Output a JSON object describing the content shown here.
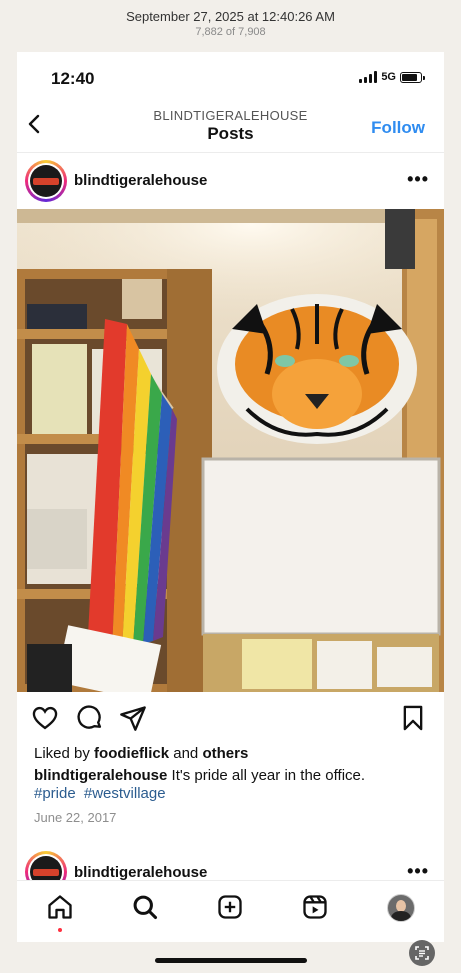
{
  "photos_header": {
    "date": "September 27, 2025 at 12:40:26 AM",
    "count": "7,882 of 7,908"
  },
  "status_bar": {
    "time": "12:40",
    "network": "5G"
  },
  "nav": {
    "subtitle": "BLINDTIGERALEHOUSE",
    "title": "Posts",
    "follow_label": "Follow",
    "back_icon": "chevron-left-icon"
  },
  "post": {
    "username": "blindtigeralehouse",
    "more_icon": "more-dots-icon",
    "photo_description_icon": "post-photo",
    "likes_prefix": "Liked by",
    "liked_by_user": "foodieflick",
    "likes_and": "and",
    "likes_others": "others",
    "caption_user": "blindtigeralehouse",
    "caption_text": "It's pride all year in the office.",
    "hashtags": [
      "#pride",
      "#westvillage"
    ],
    "date": "June 22, 2017"
  },
  "next_post": {
    "username": "blindtigeralehouse"
  },
  "tabbar": {
    "items": [
      "home-icon",
      "search-icon",
      "create-icon",
      "reels-icon",
      "profile-avatar"
    ]
  },
  "colors": {
    "accent": "#2f8cf0",
    "hashtag": "#2b5c8f",
    "notification": "#ff3040"
  }
}
